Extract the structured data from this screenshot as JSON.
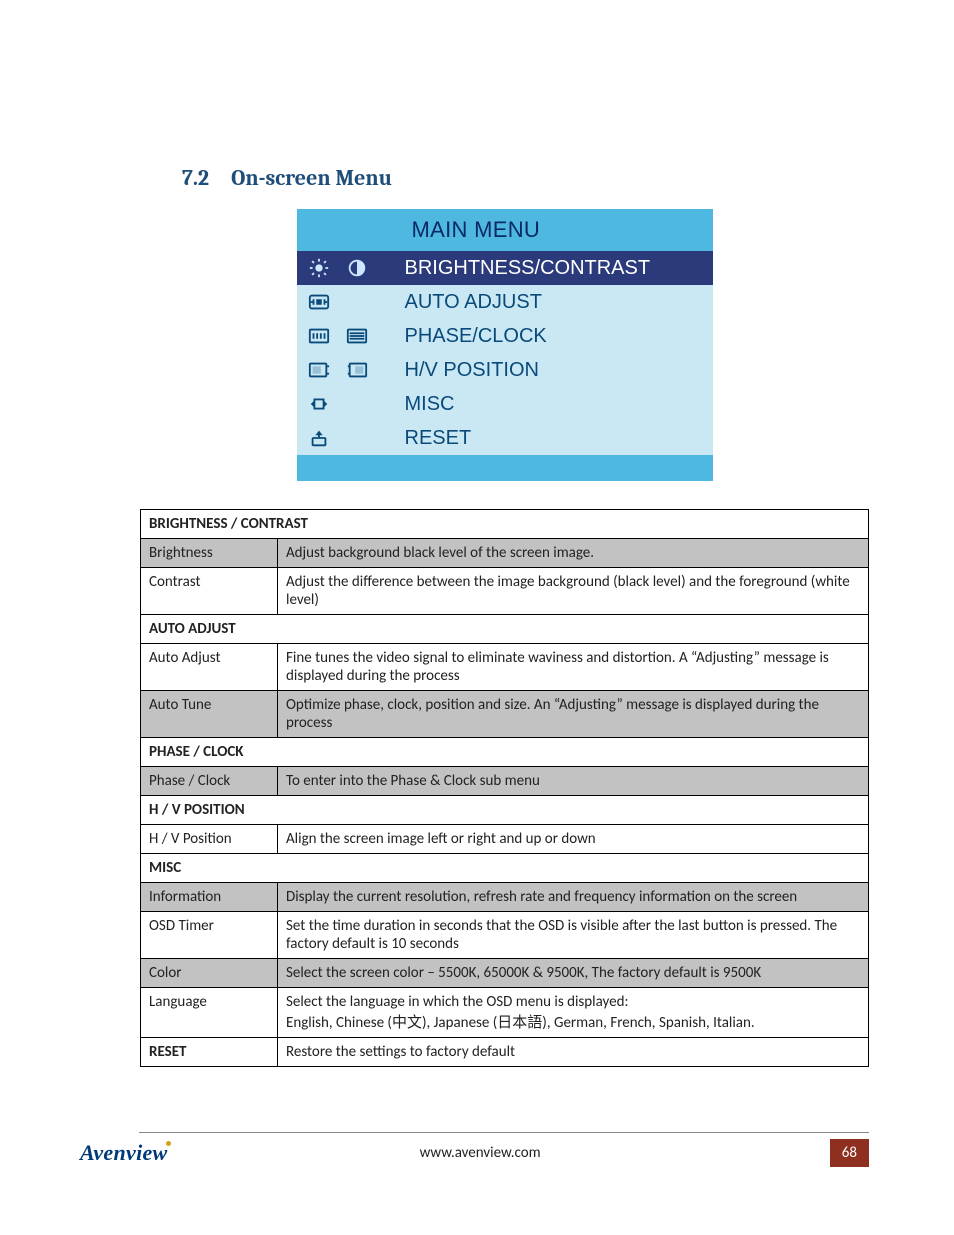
{
  "section": {
    "number": "7.2",
    "title": "On-screen Menu"
  },
  "osd": {
    "header": "MAIN MENU",
    "items": [
      {
        "label": "BRIGHTNESS/CONTRAST",
        "selected": true,
        "icons": [
          "brightness-icon",
          "contrast-icon"
        ]
      },
      {
        "label": "AUTO ADJUST",
        "selected": false,
        "icons": [
          "auto-adjust-icon"
        ]
      },
      {
        "label": "PHASE/CLOCK",
        "selected": false,
        "icons": [
          "phase-icon",
          "clock-icon"
        ]
      },
      {
        "label": "H/V POSITION",
        "selected": false,
        "icons": [
          "hpos-icon",
          "vpos-icon"
        ]
      },
      {
        "label": "MISC",
        "selected": false,
        "icons": [
          "misc-icon"
        ]
      },
      {
        "label": "RESET",
        "selected": false,
        "icons": [
          "reset-icon"
        ]
      }
    ]
  },
  "sections": [
    {
      "header": "BRIGHTNESS / CONTRAST",
      "rows": [
        {
          "name": "Brightness",
          "desc": "Adjust background black level of the screen image.",
          "alt": true
        },
        {
          "name": "Contrast",
          "desc": "Adjust the difference between the image background (black level) and the foreground (white level)",
          "alt": false
        }
      ]
    },
    {
      "header": "AUTO ADJUST",
      "rows": [
        {
          "name": "Auto Adjust",
          "desc": "Fine tunes the video signal to eliminate waviness and distortion. A “Adjusting” message is displayed during the process",
          "alt": false
        },
        {
          "name": "Auto Tune",
          "desc": "Optimize phase, clock, position and size. An “Adjusting” message is displayed during the process",
          "alt": true
        }
      ]
    },
    {
      "header": "PHASE / CLOCK",
      "rows": [
        {
          "name": "Phase / Clock",
          "desc": "To enter into the Phase & Clock sub menu",
          "alt": true
        }
      ]
    },
    {
      "header": "H / V POSITION",
      "rows": [
        {
          "name": "H / V Position",
          "desc": "Align the screen image left or right and up or down",
          "alt": false
        }
      ]
    },
    {
      "header": "MISC",
      "rows": [
        {
          "name": "Information",
          "desc": "Display the current resolution, refresh rate and frequency information on the screen",
          "alt": true
        },
        {
          "name": "OSD Timer",
          "desc": "Set the time duration in seconds that the OSD is visible after the last button is pressed. The factory default is 10 seconds",
          "alt": false
        },
        {
          "name": "Color",
          "desc": "Select the screen color – 5500K, 65000K & 9500K, The factory default is 9500K",
          "alt": true
        },
        {
          "name": "Language",
          "desc": "Select the language in which the OSD menu is displayed:\nEnglish, Chinese (中文), Japanese (日本語), German, French, Spanish, Italian.",
          "alt": false
        }
      ]
    },
    {
      "header": "RESET",
      "reset_desc": "Restore the settings to factory default"
    }
  ],
  "footer": {
    "brand": "Avenview",
    "site": "www.avenview.com",
    "page": "68"
  }
}
